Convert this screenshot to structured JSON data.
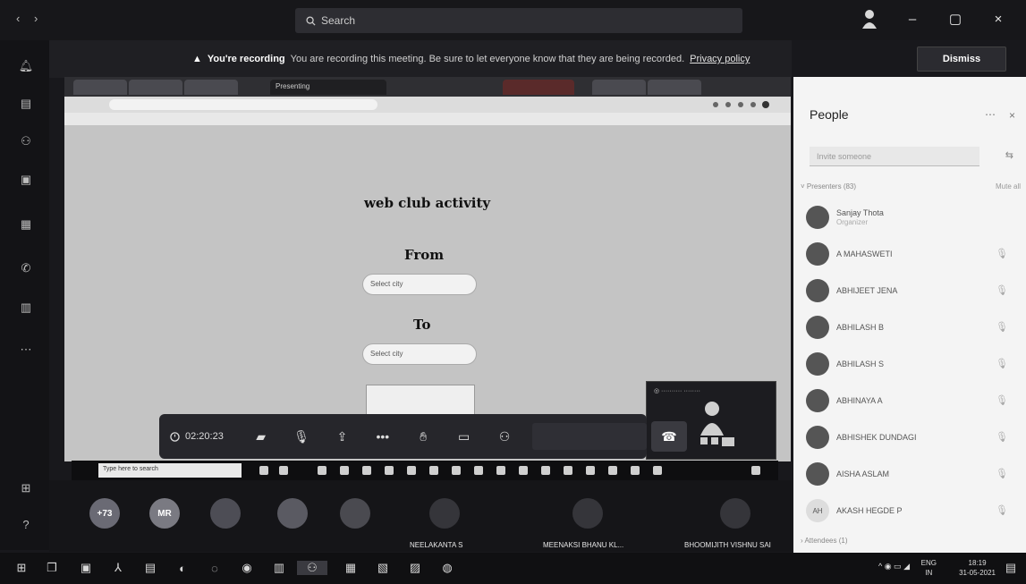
{
  "titlebar": {
    "search_placeholder": "Search",
    "search_icon": "search-icon",
    "nav_back_icon": "back-arrow-icon",
    "nav_forward_icon": "forward-arrow-icon",
    "window_controls": [
      "minimize-icon",
      "restore-icon",
      "close-icon"
    ]
  },
  "banner": {
    "warning_icon": "warning-icon",
    "bold": "You're recording",
    "text": "You are recording this meeting. Be sure to let everyone know that they are being recorded.",
    "link": "Privacy policy",
    "dismiss": "Dismiss"
  },
  "shared_page": {
    "title": "web club activity",
    "from_label": "From",
    "to_label": "To",
    "from_select": "Select city",
    "to_select": "Select city",
    "browser_tab_active": "Presenting",
    "subtask_search": "Type here to search"
  },
  "toolbar": {
    "timer": "02:20:23"
  },
  "gallery": {
    "overflow_count": "+73",
    "initials": "MR",
    "names": [
      "NEELAKANTA S",
      "MEENAKSI BHANU KL...",
      "BHOOMIJITH VISHNU SAI"
    ]
  },
  "people": {
    "title": "People",
    "more_icon": "more-options-icon",
    "close_icon": "close-icon",
    "invite_placeholder": "Invite someone",
    "presenters_label": "Presenters (83)",
    "mute_all": "Mute all",
    "presenters": [
      {
        "name": "Sanjay Thota",
        "role": "Organizer"
      },
      {
        "name": "A MAHASWETI",
        "role": ""
      },
      {
        "name": "ABHIJEET JENA",
        "role": ""
      },
      {
        "name": "ABHILASH B",
        "role": ""
      },
      {
        "name": "ABHILASH S",
        "role": ""
      },
      {
        "name": "ABHINAYA A",
        "role": ""
      },
      {
        "name": "ABHISHEK DUNDAGI",
        "role": ""
      },
      {
        "name": "AISHA ASLAM",
        "role": ""
      },
      {
        "name": "AKASH HEGDE P",
        "role": "",
        "initials": "AH"
      }
    ],
    "attendees_label": "Attendees (1)"
  },
  "taskbar": {
    "lang_top": "ENG",
    "lang_bottom": "IN",
    "time": "18:19",
    "date": "31-05-2021"
  }
}
